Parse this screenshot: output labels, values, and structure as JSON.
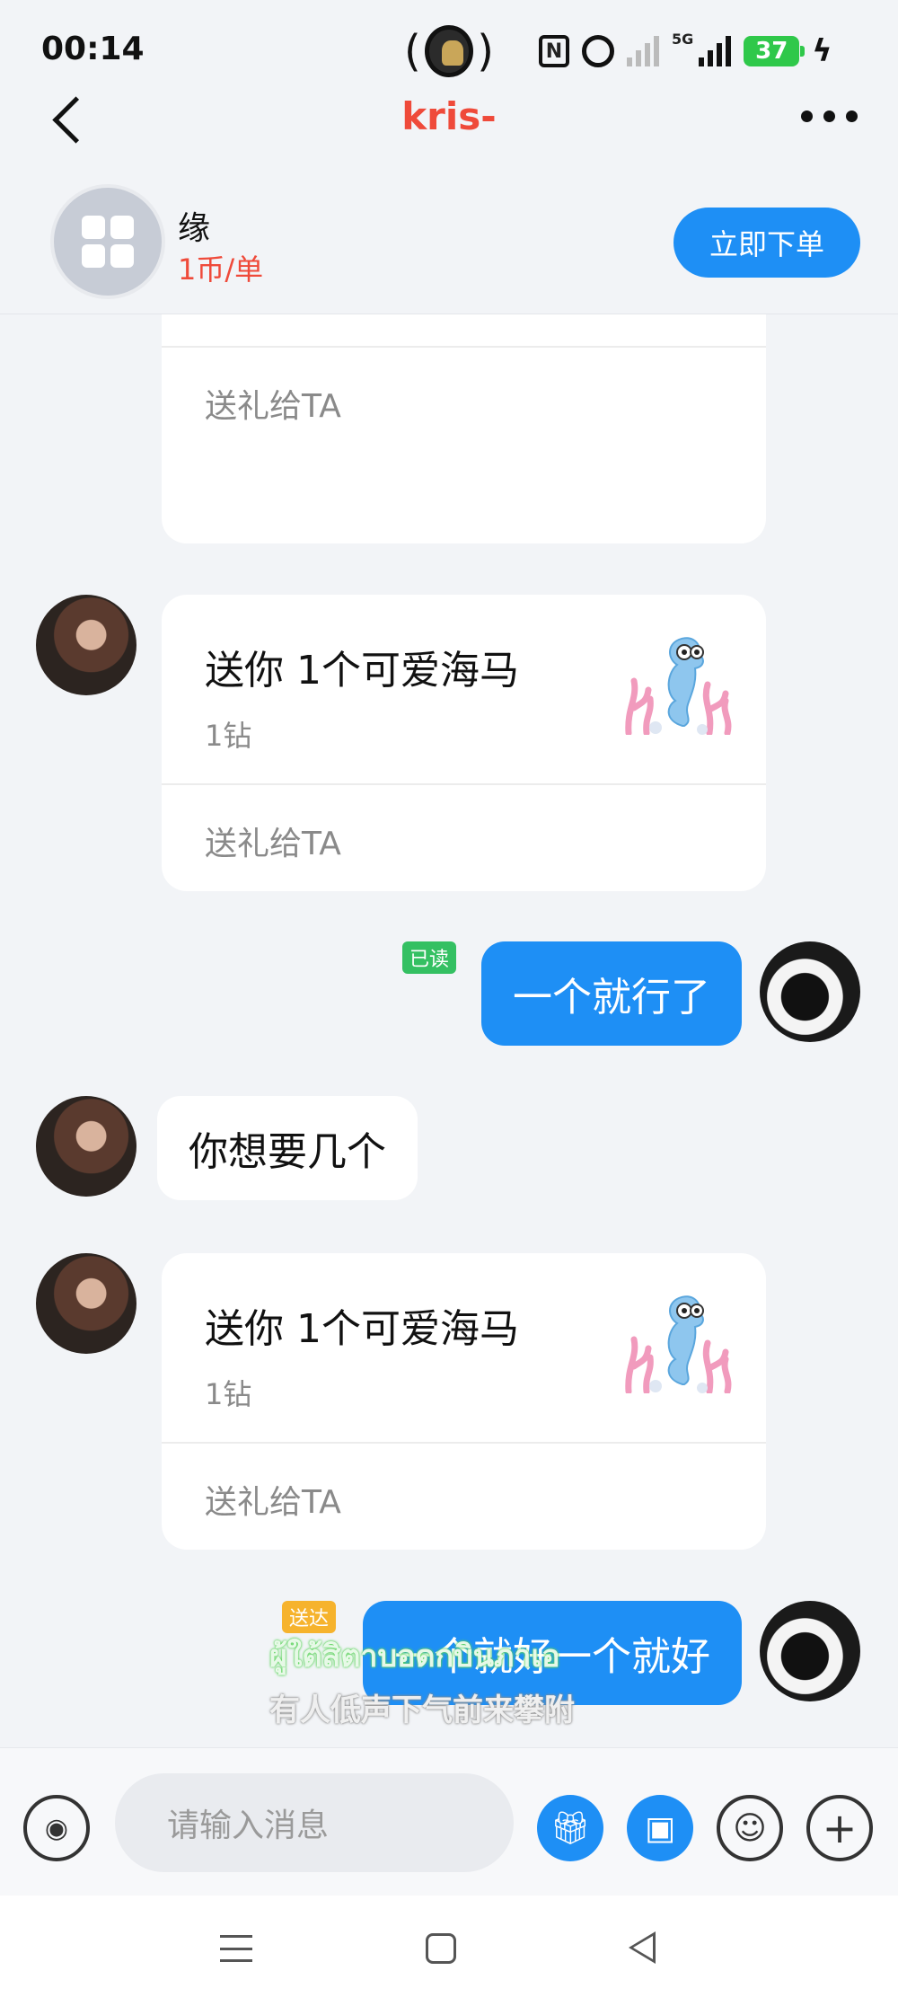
{
  "status_bar": {
    "time": "00:14",
    "network": "5G",
    "battery": "37"
  },
  "nav": {
    "title": "kris-"
  },
  "order": {
    "name": "缘",
    "price": "1币/单",
    "button": "立即下单"
  },
  "messages": {
    "gift_title": "送你 1个可爱海马",
    "gift_price": "1钻",
    "gift_action": "送礼给TA",
    "msg_me_1": "一个就行了",
    "msg_me_1_status": "已读",
    "msg_them_1": "你想要几个",
    "msg_me_2": "一个就好一个就好",
    "msg_me_2_status": "送达"
  },
  "subtitles": {
    "line1": "ผู้ใต้สิตาบอดกบินภาเอ",
    "line2": "有人低声下气前来攀附"
  },
  "input_bar": {
    "placeholder": "请输入消息"
  },
  "colors": {
    "accent": "#1e8ff5",
    "title_red": "#ef4a3a",
    "read_tag": "#34c062",
    "sent_tag": "#f6b32d"
  }
}
